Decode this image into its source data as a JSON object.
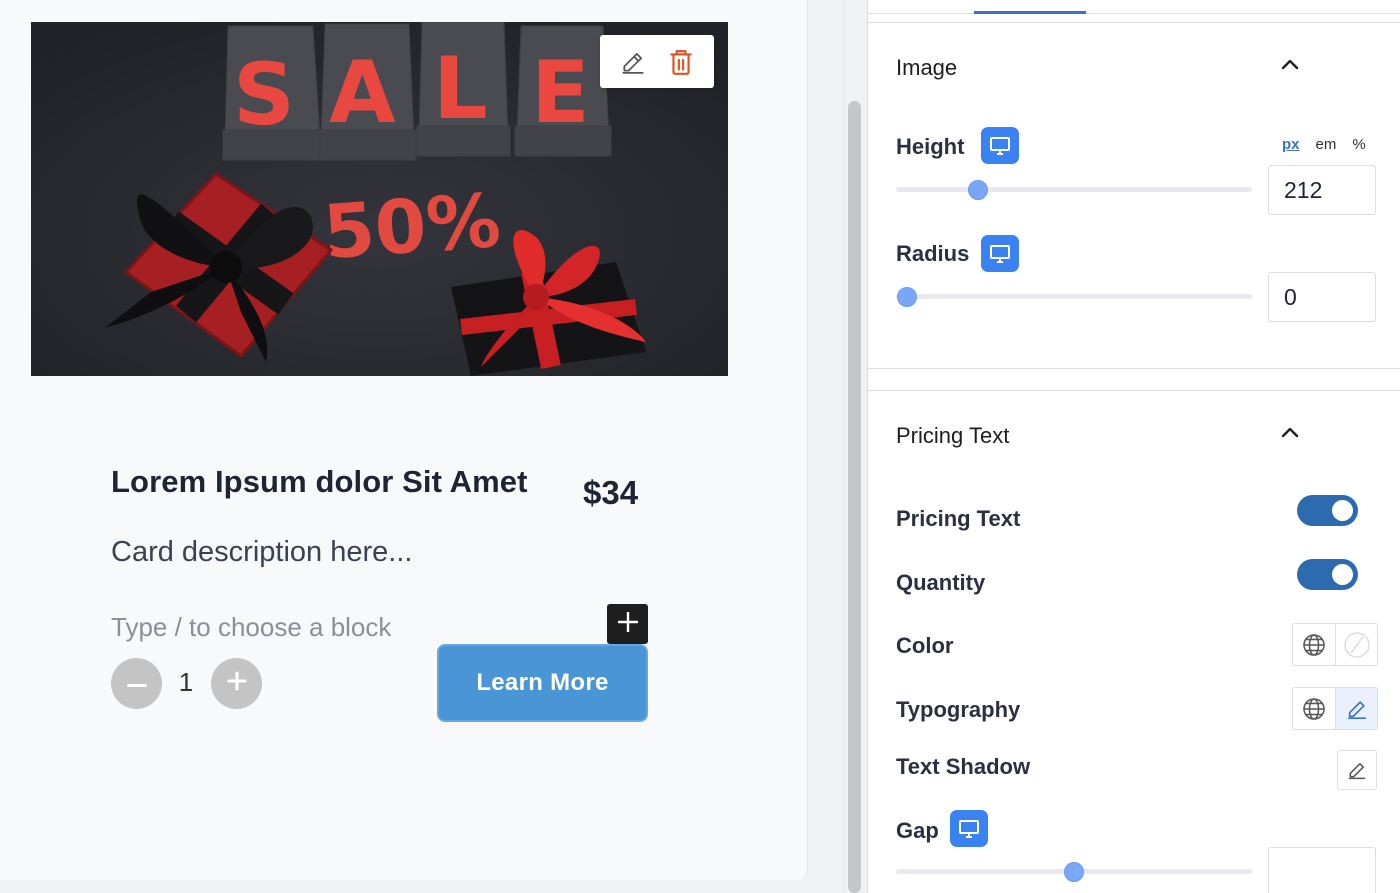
{
  "canvas": {
    "image": {
      "alt": "Sale 50% banner with gift boxes",
      "sale_text": "SALE",
      "discount_text": "50%",
      "toolbar_icons": [
        "edit-icon",
        "trash-icon"
      ]
    },
    "card": {
      "title": "Lorem Ipsum dolor Sit Amet",
      "price": "$34",
      "description": "Card description here...",
      "block_placeholder": "Type / to choose a block",
      "add_block_icon": "plus-icon",
      "quantity": "1",
      "quantity_minus_icon": "minus-icon",
      "quantity_plus_icon": "plus-icon",
      "button_label": "Learn More"
    }
  },
  "sidebar": {
    "image_panel": {
      "title": "Image",
      "expanded": true,
      "height": {
        "label": "Height",
        "device_icon": "desktop-icon",
        "units": [
          "px",
          "em",
          "%"
        ],
        "active_unit": "px",
        "value": "212",
        "slider_fraction": 0.23
      },
      "radius": {
        "label": "Radius",
        "device_icon": "desktop-icon",
        "value": "0",
        "slider_fraction": 0.03
      }
    },
    "pricing_panel": {
      "title": "Pricing Text",
      "expanded": true,
      "pricing_text": {
        "label": "Pricing Text",
        "enabled": true
      },
      "quantity": {
        "label": "Quantity",
        "enabled": true
      },
      "color": {
        "label": "Color",
        "icons": [
          "globe-icon",
          "no-color-icon"
        ]
      },
      "typography": {
        "label": "Typography",
        "icons": [
          "globe-icon",
          "pencil-icon"
        ]
      },
      "text_shadow": {
        "label": "Text Shadow",
        "icon": "pencil-icon"
      },
      "gap": {
        "label": "Gap",
        "device_icon": "desktop-icon",
        "value": "",
        "slider_fraction": 0.5
      }
    }
  },
  "colors": {
    "accent": "#3a82f0",
    "button": "#4a95d6",
    "toggle": "#2c6bb0",
    "sale_red": "#e8483f",
    "delete_icon": "#e0531f"
  }
}
